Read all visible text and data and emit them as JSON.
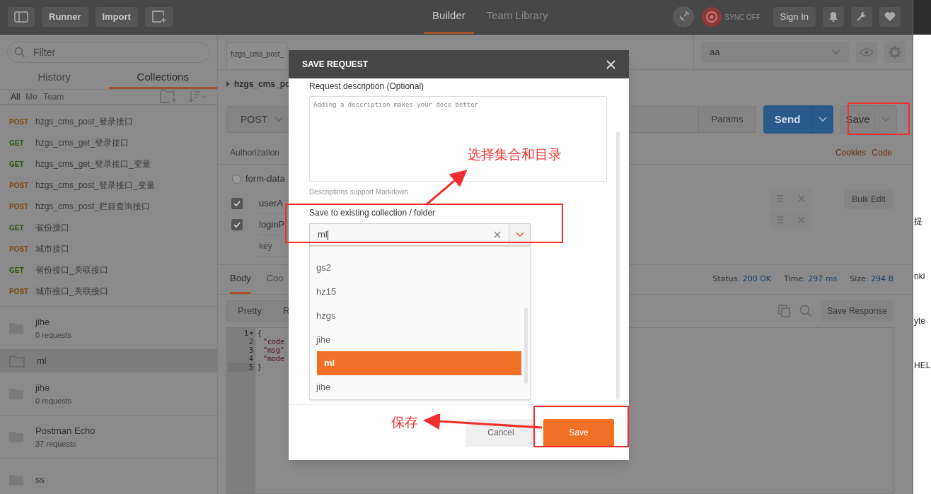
{
  "top_bar": {
    "buttons": [
      "Runner",
      "Import"
    ],
    "tabs": [
      {
        "label": "Builder",
        "selected": true
      },
      {
        "label": "Team Library",
        "selected": false
      }
    ],
    "sync": "SYNC OFF",
    "sign_in": "Sign In"
  },
  "sidebar": {
    "filter_placeholder": "Filter",
    "tabs": [
      {
        "label": "History",
        "selected": false
      },
      {
        "label": "Collections",
        "selected": true
      }
    ],
    "filters": [
      {
        "label": "All",
        "selected": true
      },
      {
        "label": "Me",
        "selected": false
      },
      {
        "label": "Team",
        "selected": false
      }
    ],
    "requests": [
      {
        "method": "POST",
        "color": "#7a4a10",
        "name": "hzgs_cms_post_登录接口"
      },
      {
        "method": "GET",
        "color": "#2e5a10",
        "name": "hzgs_cms_get_登录接口"
      },
      {
        "method": "GET",
        "color": "#2e5a10",
        "name": "hzgs_cms_get_登录接口_变量"
      },
      {
        "method": "POST",
        "color": "#7a4a10",
        "name": "hzgs_cms_post_登录接口_变量"
      },
      {
        "method": "POST",
        "color": "#7a4a10",
        "name": "hzgs_cms_post_栏目查询接口"
      },
      {
        "method": "GET",
        "color": "#2e5a10",
        "name": "省份接口"
      },
      {
        "method": "POST",
        "color": "#7a4a10",
        "name": "城市接口"
      },
      {
        "method": "GET",
        "color": "#2e5a10",
        "name": "省份接口_关联接口"
      },
      {
        "method": "POST",
        "color": "#7a4a10",
        "name": "城市接口_关联接口"
      }
    ],
    "collections": [
      {
        "name": "jihe",
        "count": "0 requests",
        "selected": false
      },
      {
        "name": "ml",
        "selected": true
      },
      {
        "name": "jihe",
        "count": "0 requests",
        "selected": false
      },
      {
        "name": "Postman Echo",
        "count": "37 requests",
        "selected": false
      },
      {
        "name": "ss",
        "selected": false
      }
    ]
  },
  "request_tab": "hzgs_cms_post_",
  "environment": "aa",
  "breadcrumb": "hzgs_cms_po",
  "request": {
    "method": "POST",
    "params": "Params",
    "send": "Send",
    "save": "Save"
  },
  "request_tabs": [
    "Authorization"
  ],
  "links": [
    "Cookies",
    "Code"
  ],
  "body_mode": {
    "label": "form-data",
    "selected": false
  },
  "params_rows": [
    {
      "key": "userA",
      "checked": true
    },
    {
      "key": "loginP",
      "checked": true
    }
  ],
  "key_placeholder": "key",
  "bulk_edit": "Bulk Edit",
  "response": {
    "tabs": [
      {
        "label": "Body",
        "selected": true
      },
      {
        "label": "Coo",
        "selected": false
      }
    ],
    "stats": [
      {
        "label": "Status:",
        "value": "200 OK"
      },
      {
        "label": "Time:",
        "value": "297 ms"
      },
      {
        "label": "Size:",
        "value": "294 B"
      }
    ],
    "views": [
      "Pretty",
      "R"
    ],
    "save_response": "Save Response",
    "lines": [
      {
        "number": "1",
        "code": "{"
      },
      {
        "number": "2",
        "code": "\"code"
      },
      {
        "number": "3",
        "code": "\"msg\""
      },
      {
        "number": "4",
        "code": "\"mode"
      },
      {
        "number": "5",
        "code": "}"
      }
    ]
  },
  "dialog": {
    "title": "SAVE REQUEST",
    "description_label": "Request description (Optional)",
    "description_placeholder": "Adding a description makes your docs better",
    "hint": "Descriptions support Markdown",
    "collection_label": "Save to existing collection / folder",
    "collection_value": "ml",
    "options": [
      {
        "label": "gs2",
        "selected": false
      },
      {
        "label": "hz15",
        "selected": false
      },
      {
        "label": "hzgs",
        "selected": false
      },
      {
        "label": "jihe",
        "selected": false
      },
      {
        "label": "ml",
        "selected": true
      },
      {
        "label": "jihe",
        "selected": false
      }
    ],
    "cancel": "Cancel",
    "save": "Save"
  },
  "annotations": [
    {
      "text": "选择集合和目录"
    },
    {
      "text": "保存"
    }
  ],
  "right_window": [
    "提",
    "nki",
    "yte",
    "HEL"
  ]
}
